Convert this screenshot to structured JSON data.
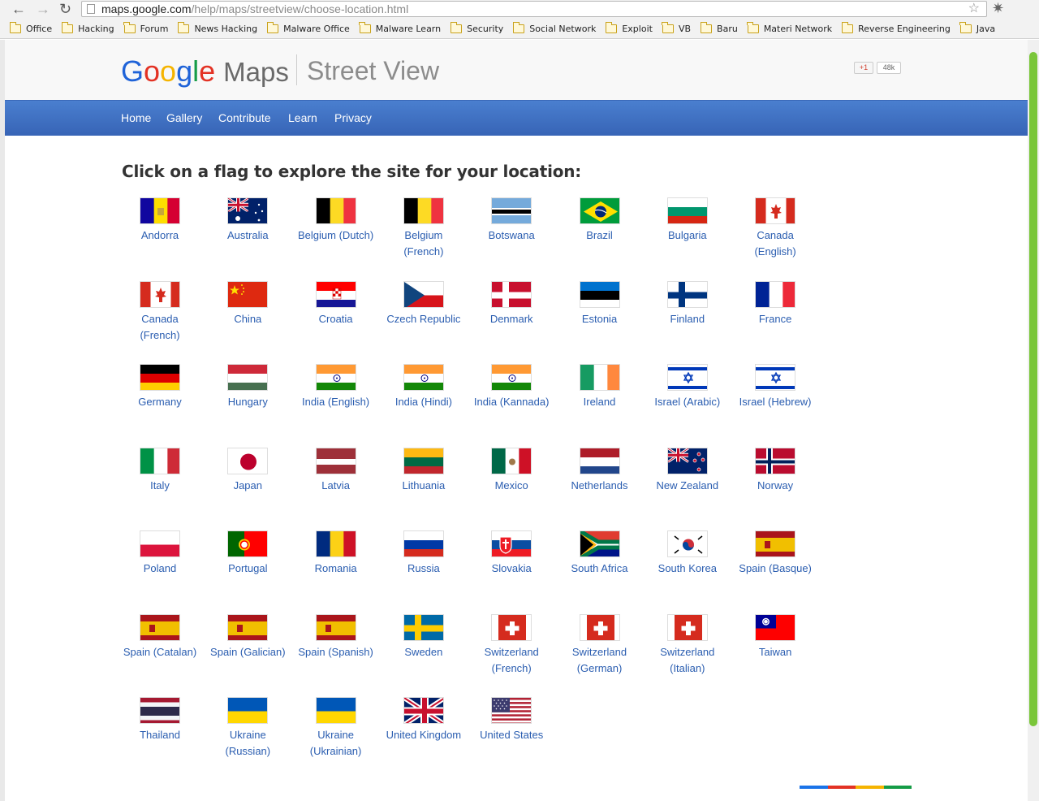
{
  "browser": {
    "url_host": "maps.google.com",
    "url_path": "/help/maps/streetview/choose-location.html",
    "bookmarks": [
      "Office",
      "Hacking",
      "Forum",
      "News Hacking",
      "Malware Office",
      "Malware Learn",
      "Security",
      "Social Network",
      "Exploit",
      "VB",
      "Baru",
      "Materi Network",
      "Reverse Engineering",
      "Java"
    ]
  },
  "header": {
    "logo_google": [
      "G",
      "o",
      "o",
      "g",
      "l",
      "e"
    ],
    "logo_maps": "Maps",
    "product": "Street View",
    "plusone_label": "+1",
    "plusone_count": "48k"
  },
  "nav": [
    "Home",
    "Gallery",
    "Contribute",
    "Learn",
    "Privacy"
  ],
  "main": {
    "heading": "Click on a flag to explore the site for your location:"
  },
  "locations": [
    {
      "label": "Andorra",
      "flag": "andorra"
    },
    {
      "label": "Australia",
      "flag": "australia"
    },
    {
      "label": "Belgium (Dutch)",
      "flag": "belgium"
    },
    {
      "label": "Belgium (French)",
      "flag": "belgium"
    },
    {
      "label": "Botswana",
      "flag": "botswana"
    },
    {
      "label": "Brazil",
      "flag": "brazil"
    },
    {
      "label": "Bulgaria",
      "flag": "bulgaria"
    },
    {
      "label": "Canada (English)",
      "flag": "canada"
    },
    {
      "label": "Canada (French)",
      "flag": "canada"
    },
    {
      "label": "China",
      "flag": "china"
    },
    {
      "label": "Croatia",
      "flag": "croatia"
    },
    {
      "label": "Czech Republic",
      "flag": "czech"
    },
    {
      "label": "Denmark",
      "flag": "denmark"
    },
    {
      "label": "Estonia",
      "flag": "estonia"
    },
    {
      "label": "Finland",
      "flag": "finland"
    },
    {
      "label": "France",
      "flag": "france"
    },
    {
      "label": "Germany",
      "flag": "germany"
    },
    {
      "label": "Hungary",
      "flag": "hungary"
    },
    {
      "label": "India (English)",
      "flag": "india"
    },
    {
      "label": "India (Hindi)",
      "flag": "india"
    },
    {
      "label": "India (Kannada)",
      "flag": "india"
    },
    {
      "label": "Ireland",
      "flag": "ireland"
    },
    {
      "label": "Israel (Arabic)",
      "flag": "israel"
    },
    {
      "label": "Israel (Hebrew)",
      "flag": "israel"
    },
    {
      "label": "Italy",
      "flag": "italy"
    },
    {
      "label": "Japan",
      "flag": "japan"
    },
    {
      "label": "Latvia",
      "flag": "latvia"
    },
    {
      "label": "Lithuania",
      "flag": "lithuania"
    },
    {
      "label": "Mexico",
      "flag": "mexico"
    },
    {
      "label": "Netherlands",
      "flag": "netherlands"
    },
    {
      "label": "New Zealand",
      "flag": "newzealand"
    },
    {
      "label": "Norway",
      "flag": "norway"
    },
    {
      "label": "Poland",
      "flag": "poland"
    },
    {
      "label": "Portugal",
      "flag": "portugal"
    },
    {
      "label": "Romania",
      "flag": "romania"
    },
    {
      "label": "Russia",
      "flag": "russia"
    },
    {
      "label": "Slovakia",
      "flag": "slovakia"
    },
    {
      "label": "South Africa",
      "flag": "southafrica"
    },
    {
      "label": "South Korea",
      "flag": "southkorea"
    },
    {
      "label": "Spain (Basque)",
      "flag": "spain"
    },
    {
      "label": "Spain (Catalan)",
      "flag": "spain"
    },
    {
      "label": "Spain (Galician)",
      "flag": "spain"
    },
    {
      "label": "Spain (Spanish)",
      "flag": "spain"
    },
    {
      "label": "Sweden",
      "flag": "sweden"
    },
    {
      "label": "Switzerland (French)",
      "flag": "switzerland"
    },
    {
      "label": "Switzerland (German)",
      "flag": "switzerland"
    },
    {
      "label": "Switzerland (Italian)",
      "flag": "switzerland"
    },
    {
      "label": "Taiwan",
      "flag": "taiwan"
    },
    {
      "label": "Thailand",
      "flag": "thailand"
    },
    {
      "label": "Ukraine (Russian)",
      "flag": "ukraine"
    },
    {
      "label": "Ukraine (Ukrainian)",
      "flag": "ukraine"
    },
    {
      "label": "United Kingdom",
      "flag": "uk"
    },
    {
      "label": "United States",
      "flag": "usa"
    }
  ],
  "colors": {
    "nav_bar": "#3f6fc2",
    "link": "#2a5db0",
    "scrollbar": "#7ac63a",
    "footer_stripes": [
      "#1a73e8",
      "#e33224",
      "#f5b400",
      "#159c46"
    ]
  }
}
